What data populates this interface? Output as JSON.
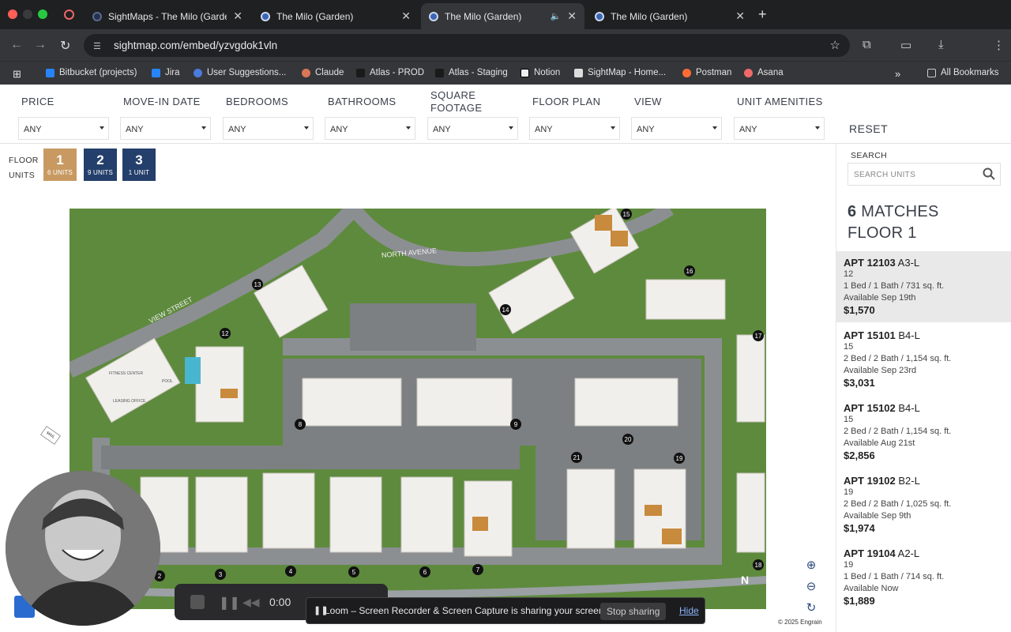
{
  "browser": {
    "tabs": [
      {
        "title": "SightMaps - The Milo (Garden",
        "active": false
      },
      {
        "title": "The Milo (Garden)",
        "active": false
      },
      {
        "title": "The Milo (Garden)",
        "active": true
      },
      {
        "title": "The Milo (Garden)",
        "active": false
      }
    ],
    "url": "sightmap.com/embed/yzvgdok1vln",
    "bookmarks": [
      "Bitbucket (projects)",
      "Jira",
      "User Suggestions...",
      "Claude",
      "Atlas - PROD",
      "Atlas - Staging",
      "Notion",
      "SightMap - Home...",
      "Postman",
      "Asana"
    ],
    "all_bookmarks": "All Bookmarks"
  },
  "filters": [
    {
      "label": "PRICE",
      "value": "ANY"
    },
    {
      "label": "MOVE-IN DATE",
      "value": "ANY"
    },
    {
      "label": "BEDROOMS",
      "value": "ANY"
    },
    {
      "label": "BATHROOMS",
      "value": "ANY"
    },
    {
      "label": "SQUARE FOOTAGE",
      "value": "ANY"
    },
    {
      "label": "FLOOR PLAN",
      "value": "ANY"
    },
    {
      "label": "VIEW",
      "value": "ANY"
    },
    {
      "label": "UNIT AMENITIES",
      "value": "ANY"
    }
  ],
  "reset_label": "RESET",
  "floor_selector": {
    "label_floor": "FLOOR",
    "label_units": "UNITS",
    "floors": [
      {
        "number": "1",
        "units": "6 UNITS",
        "color": "#c89a62"
      },
      {
        "number": "2",
        "units": "9 UNITS",
        "color": "#243f6b"
      },
      {
        "number": "3",
        "units": "1 UNIT",
        "color": "#243f6b"
      }
    ]
  },
  "map": {
    "streets": [
      "NORTH AVENUE",
      "VIEW STREET"
    ],
    "building_numbers": [
      "2",
      "3",
      "4",
      "5",
      "6",
      "7",
      "8",
      "9",
      "12",
      "13",
      "14",
      "15",
      "16",
      "17",
      "18",
      "19",
      "20",
      "21"
    ],
    "buildings_labels": [
      "FITNESS CENTER",
      "LEASING OFFICE",
      "POOL",
      "MAIL"
    ],
    "highlight_units": [
      "12103",
      "15101",
      "15102",
      "19102",
      "19104",
      "7104"
    ],
    "north": "N",
    "copyright": "© 2025 Engrain"
  },
  "sidebar": {
    "search_label": "SEARCH",
    "search_placeholder": "SEARCH UNITS",
    "matches_count": "6",
    "matches_text": "MATCHES",
    "floor_text": "FLOOR 1",
    "units": [
      {
        "apt": "APT 12103",
        "plan": "A3-L",
        "building": "12",
        "details": "1 Bed / 1 Bath / 731 sq. ft.",
        "available": "Available Sep 19th",
        "price": "$1,570"
      },
      {
        "apt": "APT 15101",
        "plan": "B4-L",
        "building": "15",
        "details": "2 Bed / 2 Bath / 1,154 sq. ft.",
        "available": "Available Sep 23rd",
        "price": "$3,031"
      },
      {
        "apt": "APT 15102",
        "plan": "B4-L",
        "building": "15",
        "details": "2 Bed / 2 Bath / 1,154 sq. ft.",
        "available": "Available Aug 21st",
        "price": "$2,856"
      },
      {
        "apt": "APT 19102",
        "plan": "B2-L",
        "building": "19",
        "details": "2 Bed / 2 Bath / 1,025 sq. ft.",
        "available": "Available Sep 9th",
        "price": "$1,974"
      },
      {
        "apt": "APT 19104",
        "plan": "A2-L",
        "building": "19",
        "details": "1 Bed / 1 Bath / 714 sq. ft.",
        "available": "Available Now",
        "price": "$1,889"
      }
    ]
  },
  "loom": {
    "timer": "0:00",
    "sharing_text": "Loom – Screen Recorder & Screen Capture is sharing your screen.",
    "stop_label": "Stop sharing",
    "hide_label": "Hide"
  }
}
